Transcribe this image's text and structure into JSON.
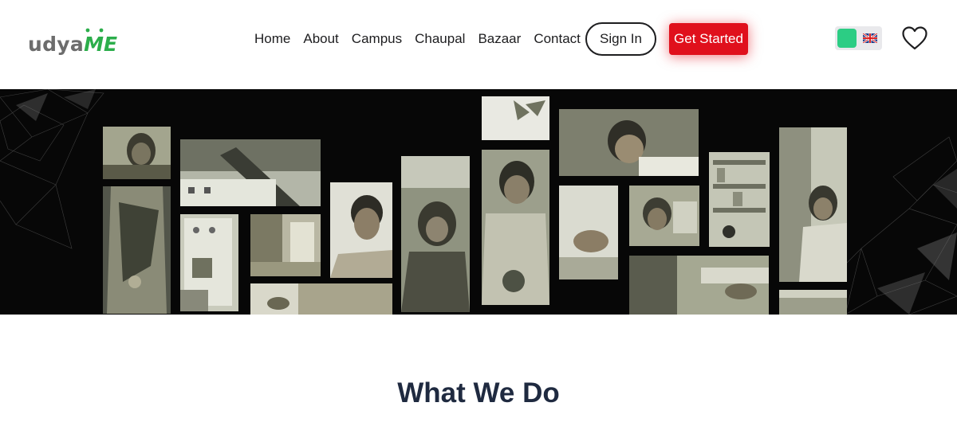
{
  "brand": {
    "logo_prefix": "udya",
    "logo_suffix": "ME",
    "accent_color": "#2cae4b"
  },
  "nav": {
    "items": [
      {
        "label": "Home"
      },
      {
        "label": "About"
      },
      {
        "label": "Campus"
      },
      {
        "label": "Chaupal"
      },
      {
        "label": "Bazaar"
      },
      {
        "label": "Contact"
      }
    ],
    "signin_label": "Sign In",
    "get_started_label": "Get Started",
    "cta_color": "#e0101c"
  },
  "language_toggle": {
    "active_color": "#2ccd84",
    "flag_icon": "uk-flag-icon"
  },
  "favorites": {
    "icon": "heart-icon"
  },
  "hero": {
    "icon": "photo-collage",
    "tone": "monochrome-sepia"
  },
  "sections": {
    "what_we_do_title": "What We Do"
  }
}
